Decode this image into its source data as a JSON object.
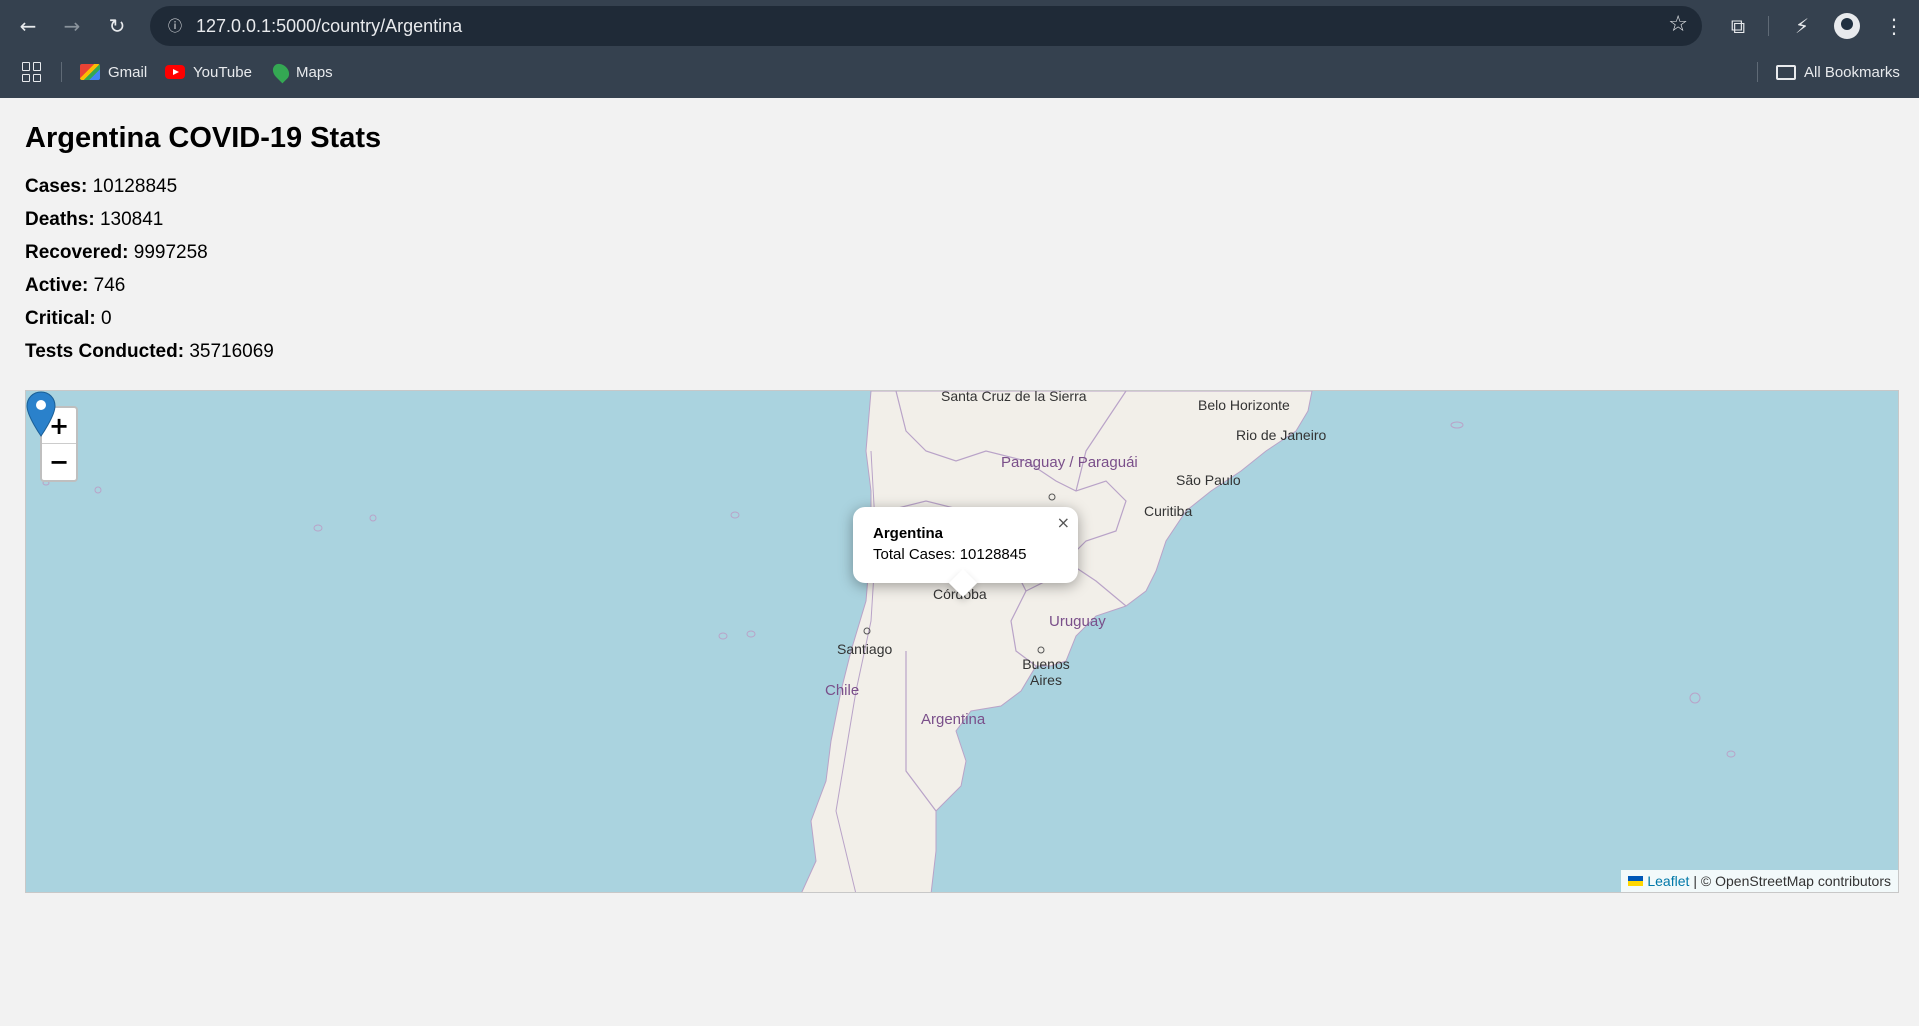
{
  "browser": {
    "url": "127.0.0.1:5000/country/Argentina",
    "bookmarks": [
      {
        "label": "Gmail",
        "icon": "gmail-icon"
      },
      {
        "label": "YouTube",
        "icon": "youtube-icon"
      },
      {
        "label": "Maps",
        "icon": "maps-icon"
      }
    ],
    "all_bookmarks_label": "All Bookmarks"
  },
  "page": {
    "title": "Argentina COVID-19 Stats",
    "stats": [
      {
        "label": "Cases:",
        "value": "10128845"
      },
      {
        "label": "Deaths:",
        "value": "130841"
      },
      {
        "label": "Recovered:",
        "value": "9997258"
      },
      {
        "label": "Active:",
        "value": "746"
      },
      {
        "label": "Critical:",
        "value": "0"
      },
      {
        "label": "Tests Conducted:",
        "value": "35716069"
      }
    ]
  },
  "map": {
    "zoom_in_label": "+",
    "zoom_out_label": "−",
    "popup": {
      "title": "Argentina",
      "text": "Total Cases: 10128845",
      "close_label": "×"
    },
    "labels": {
      "santa_cruz": "Santa Cruz de la Sierra",
      "belo_horizonte": "Belo Horizonte",
      "rio": "Rio de Janeiro",
      "paraguay": "Paraguay / Paraguái",
      "sao_paulo": "São Paulo",
      "curitiba": "Curitiba",
      "cordoba": "Córdoba",
      "santiago": "Santiago",
      "uruguay": "Uruguay",
      "buenos_aires": "Buenos Aires",
      "chile": "Chile",
      "argentina": "Argentina"
    },
    "attribution": {
      "leaflet": "Leaflet",
      "rest": "| © OpenStreetMap contributors"
    },
    "colors": {
      "water": "#aad3df",
      "land": "#f2efe9",
      "border": "#b9a3c8",
      "marker": "#2a81cb"
    }
  }
}
